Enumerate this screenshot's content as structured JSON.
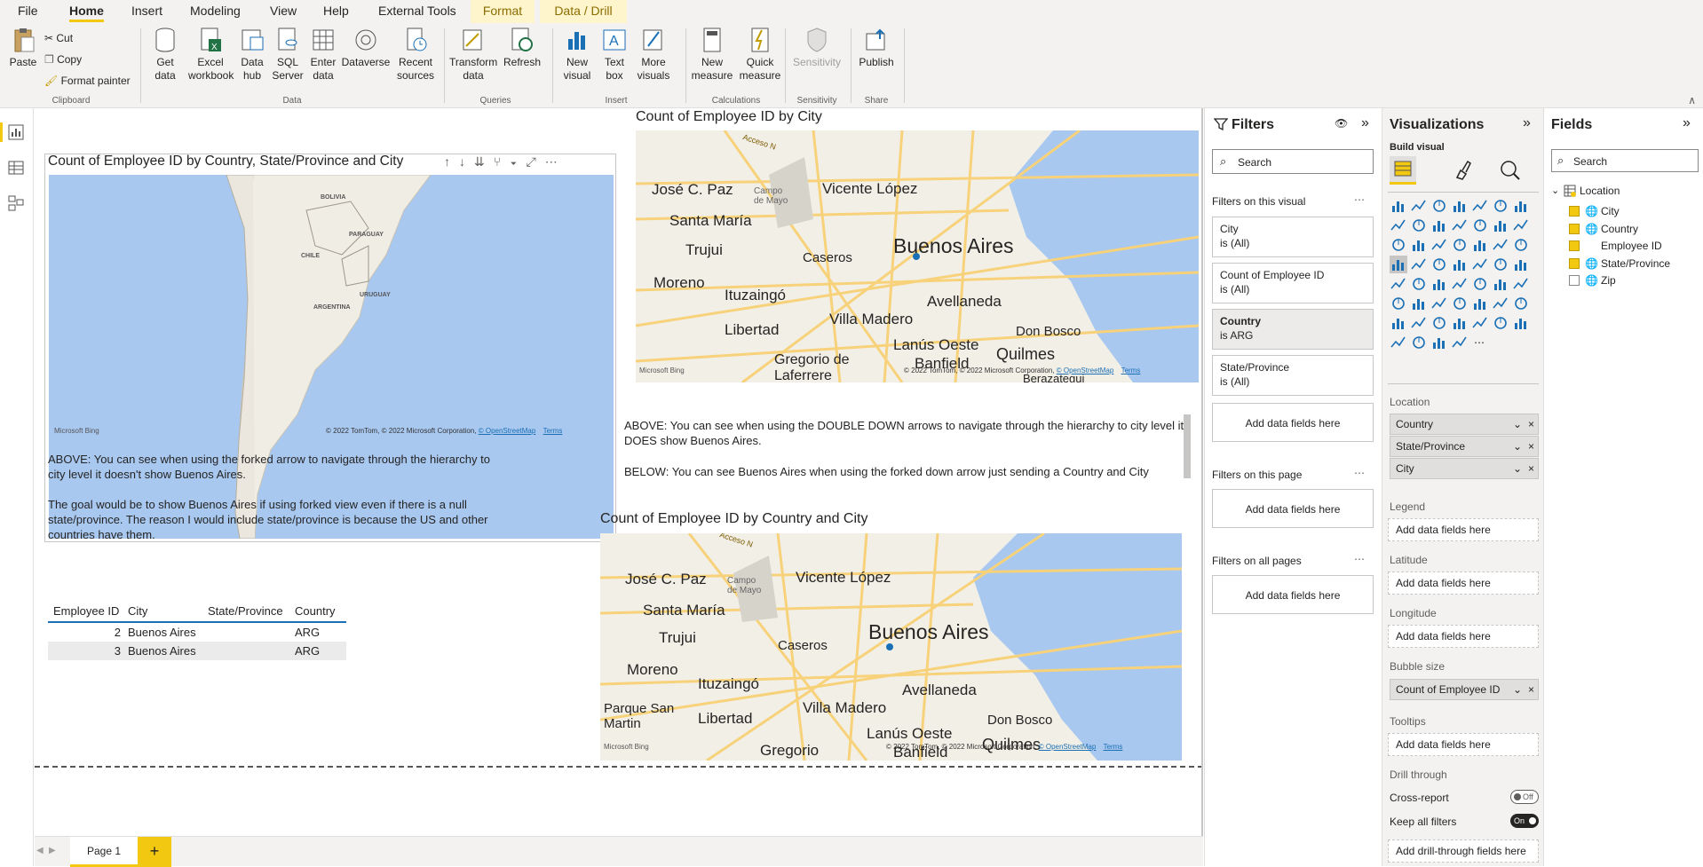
{
  "menu": {
    "tabs": [
      "File",
      "Home",
      "Insert",
      "Modeling",
      "View",
      "Help",
      "External Tools",
      "Format",
      "Data / Drill"
    ]
  },
  "ribbon": {
    "clipboard": {
      "paste": "Paste",
      "cut": "Cut",
      "copy": "Copy",
      "format_painter": "Format painter",
      "label": "Clipboard"
    },
    "data": {
      "get_data": [
        "Get",
        "data"
      ],
      "excel": [
        "Excel",
        "workbook"
      ],
      "data_hub": [
        "Data",
        "hub"
      ],
      "sql": [
        "SQL",
        "Server"
      ],
      "enter": [
        "Enter",
        "data"
      ],
      "dataverse": "Dataverse",
      "recent": [
        "Recent",
        "sources"
      ],
      "label": "Data"
    },
    "queries": {
      "transform": [
        "Transform",
        "data"
      ],
      "refresh": "Refresh",
      "label": "Queries"
    },
    "insert": {
      "new_visual": [
        "New",
        "visual"
      ],
      "text_box": [
        "Text",
        "box"
      ],
      "more_visuals": [
        "More",
        "visuals"
      ],
      "label": "Insert"
    },
    "calculations": {
      "new_measure": [
        "New",
        "measure"
      ],
      "quick_measure": [
        "Quick",
        "measure"
      ],
      "label": "Calculations"
    },
    "sensitivity": {
      "btn": "Sensitivity",
      "label": "Sensitivity"
    },
    "share": {
      "publish": "Publish",
      "label": "Share"
    }
  },
  "canvas": {
    "visual1": {
      "title": "Count of Employee ID by Country, State/Province and City",
      "map_labels": [
        "BOLIVIA",
        "PARAGUAY",
        "CHILE",
        "URUGUAY",
        "ARGENTINA"
      ],
      "credit": "© 2022 TomTom, © 2022 Microsoft Corporation,",
      "osm": "© OpenStreetMap",
      "terms": "Terms",
      "bing": "Microsoft Bing"
    },
    "visual2": {
      "title": "Count of Employee ID by City",
      "credit": "© 2022 TomTom, © 2022 Microsoft Corporation,",
      "osm": "© OpenStreetMap",
      "terms": "Terms",
      "bing": "Microsoft Bing"
    },
    "visual3": {
      "title": "Count of Employee ID by Country and City",
      "credit": "© 2022 TomTom, © 2022 Microsoft Corporation,",
      "osm": "© OpenStreetMap",
      "terms": "Terms",
      "bing": "Microsoft Bing"
    },
    "city_labels": {
      "jose": "José C. Paz",
      "campo": "Campo de Mayo",
      "vicente": "Vicente López",
      "santa": "Santa María",
      "trujui": "Trujui",
      "caseros": "Caseros",
      "ba": "Buenos Aires",
      "moreno": "Moreno",
      "ituz": "Ituzaingó",
      "avellaneda": "Avellaneda",
      "libertad": "Libertad",
      "villa": "Villa Madero",
      "donbosco": "Don Bosco",
      "gregorio": "Gregorio de Laferrere",
      "lanus": "Lanús Oeste",
      "banfield": "Banfield",
      "quilmes": "Quilmes",
      "berazategui": "Berazategui",
      "parque": "Parque San Martin",
      "acceso": "Acceso N"
    },
    "text_left_1": "ABOVE: You can see when using the forked arrow to navigate through the hierarchy to city level it doesn't show Buenos Aires.",
    "text_left_2": "The goal would be to show Buenos Aires if using forked view even if there is a null state/province. The reason I would include state/province is because the US and other countries have them.",
    "text_right_1": "ABOVE: You can see  when using the DOUBLE DOWN arrows to navigate through the hierarchy to city level it DOES show Buenos Aires.",
    "text_right_2": "BELOW: You can see Buenos Aires when using the forked down arrow just sending a Country and City",
    "table": {
      "headers": [
        "Employee ID",
        "City",
        "State/Province",
        "Country"
      ],
      "rows": [
        [
          "2",
          "Buenos Aires",
          "",
          "ARG"
        ],
        [
          "3",
          "Buenos Aires",
          "",
          "ARG"
        ]
      ]
    }
  },
  "statusbar": {
    "page_tab": "Page 1",
    "add": "+"
  },
  "filters": {
    "title": "Filters",
    "search_placeholder": "Search",
    "on_visual": "Filters on this visual",
    "cards": [
      {
        "name": "City",
        "value": "is (All)"
      },
      {
        "name": "Count of Employee ID",
        "value": "is (All)"
      },
      {
        "name": "Country",
        "value": "is ARG"
      },
      {
        "name": "State/Province",
        "value": "is (All)"
      }
    ],
    "add": "Add data fields here",
    "on_page": "Filters on this page",
    "on_all": "Filters on all pages"
  },
  "visualizations": {
    "title": "Visualizations",
    "build": "Build visual",
    "location_label": "Location",
    "location_wells": [
      "Country",
      "State/Province",
      "City"
    ],
    "legend": "Legend",
    "latitude": "Latitude",
    "longitude": "Longitude",
    "bubble": "Bubble size",
    "bubble_well": "Count of Employee ID",
    "tooltips": "Tooltips",
    "drill": "Drill through",
    "cross": "Cross-report",
    "cross_state": "Off",
    "keep": "Keep all filters",
    "keep_state": "On",
    "add": "Add data fields here",
    "add_drill": "Add drill-through fields here"
  },
  "fields": {
    "title": "Fields",
    "search_placeholder": "Search",
    "table": "Location",
    "items": [
      {
        "name": "City",
        "checked": true
      },
      {
        "name": "Country",
        "checked": true
      },
      {
        "name": "Employee ID",
        "checked": true
      },
      {
        "name": "State/Province",
        "checked": true
      },
      {
        "name": "Zip",
        "checked": false
      }
    ]
  },
  "colors": {
    "accent": "#f2c811",
    "water": "#a8c8f0",
    "land": "#f0ede5",
    "road": "#f7d27a"
  }
}
